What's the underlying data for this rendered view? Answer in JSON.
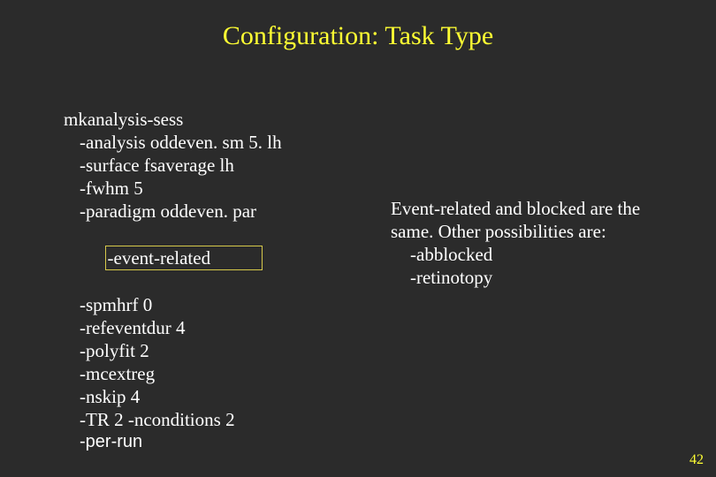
{
  "title": "Configuration: Task Type",
  "left": {
    "cmd": "mkanalysis-sess",
    "l1": "-analysis oddeven. sm 5. lh",
    "l2": "-surface fsaverage lh",
    "l3": "-fwhm 5",
    "l4": "-paradigm oddeven. par",
    "l5": "-event-related",
    "l6": "-spmhrf 0",
    "l7": "-refeventdur 4",
    "l8": "-polyfit 2",
    "l9": "-mcextreg",
    "l10": "-nskip 4",
    "l11": "-TR 2 -nconditions 2",
    "l12": "-per-run"
  },
  "right": {
    "line1": "Event-related and blocked are the",
    "line2": "same. Other possibilities are:",
    "opt1": "-abblocked",
    "opt2": "-retinotopy"
  },
  "page": "42"
}
